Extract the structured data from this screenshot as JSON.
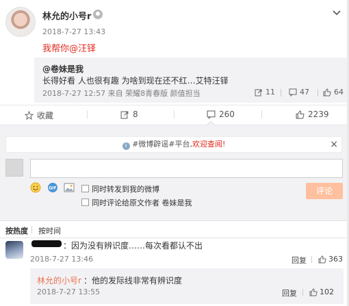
{
  "post": {
    "username": "林允的小号r",
    "time": "2018-7-27 13:43",
    "text": "我帮你@汪铎"
  },
  "quote": {
    "user": "@卷妹是我",
    "text": "长得好看 人也很有趣 为啥到现在还不红…艾特汪铎",
    "meta": "2018-7-27 12:57 来自 荣耀8青春版 颜值担当",
    "forward_count": "11",
    "comment_count": "47",
    "like_count": "64"
  },
  "actions": {
    "favorite": "收藏",
    "forward": "8",
    "comment": "260",
    "like": "2239"
  },
  "notice": {
    "tag": "#微博辟谣#平台,",
    "link": "欢迎查阅!",
    "close": "×"
  },
  "composer": {
    "placeholder": "",
    "opt1": "同时转发到我的微博",
    "opt2": "同时评论给原文作者 卷妹是我",
    "submit": "评论"
  },
  "sort": {
    "hot": "按热度",
    "time": "按时间"
  },
  "comments": [
    {
      "text": "：因为没有辨识度……每次看都认不出",
      "time": "2018-7-27 13:46",
      "reply": "回复",
      "likes": "363",
      "subreply": {
        "name": "林允的小号r",
        "text": "：他的发际线非常有辨识度",
        "time": "2018-7-27 13:55",
        "reply": "回复",
        "likes": "102"
      }
    }
  ],
  "colors": {
    "accent": "#e0291e",
    "link": "#eb7350",
    "submit": "#ffc09f"
  }
}
